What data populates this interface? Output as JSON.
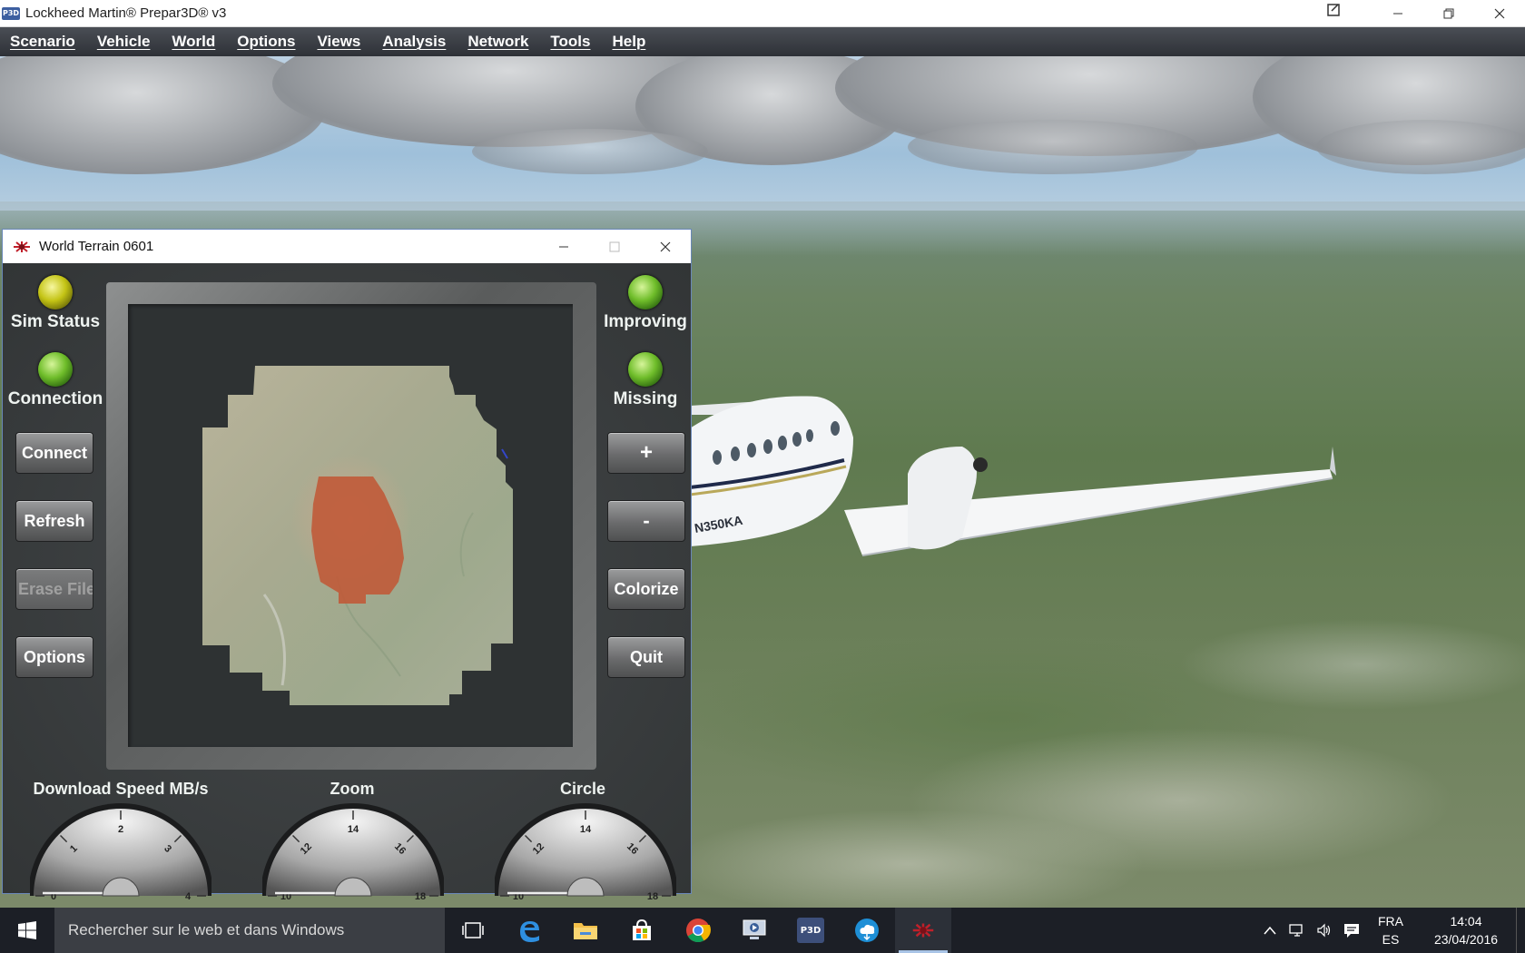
{
  "app": {
    "title": "Lockheed Martin® Prepar3D® v3",
    "icon_text": "P3D"
  },
  "menubar": {
    "items": [
      "Scenario",
      "Vehicle",
      "World",
      "Options",
      "Views",
      "Analysis",
      "Network",
      "Tools",
      "Help"
    ]
  },
  "airplane": {
    "registration": "N350KA"
  },
  "terrain_window": {
    "title": "World Terrain 0601",
    "indicators": {
      "sim_status": {
        "label": "Sim Status",
        "color": "yellow"
      },
      "connection": {
        "label": "Connection",
        "color": "green"
      },
      "improving": {
        "label": "Improving",
        "color": "green"
      },
      "missing": {
        "label": "Missing",
        "color": "green"
      }
    },
    "buttons": {
      "connect": "Connect",
      "refresh": "Refresh",
      "erase_files": "Erase Files",
      "options": "Options",
      "plus": "+",
      "minus": "-",
      "colorize": "Colorize",
      "quit": "Quit"
    },
    "gauges": {
      "download": {
        "label": "Download Speed MB/s",
        "ticks": [
          "0",
          "1",
          "2",
          "3",
          "4"
        ],
        "value": 0
      },
      "zoom": {
        "label": "Zoom",
        "ticks": [
          "10",
          "12",
          "14",
          "16",
          "18"
        ],
        "value": 10
      },
      "circle": {
        "label": "Circle",
        "ticks": [
          "10",
          "12",
          "14",
          "16",
          "18"
        ],
        "value": 10
      }
    }
  },
  "taskbar": {
    "search_placeholder": "Rechercher sur le web et dans Windows",
    "apps": [
      "task-view",
      "edge",
      "file-explorer",
      "store",
      "chrome",
      "media-app",
      "p3d",
      "weather-app",
      "world-terrain"
    ],
    "p3d_label": "P3D",
    "lang_primary": "FRA",
    "lang_secondary": "ES",
    "time": "14:04",
    "date": "23/04/2016"
  }
}
